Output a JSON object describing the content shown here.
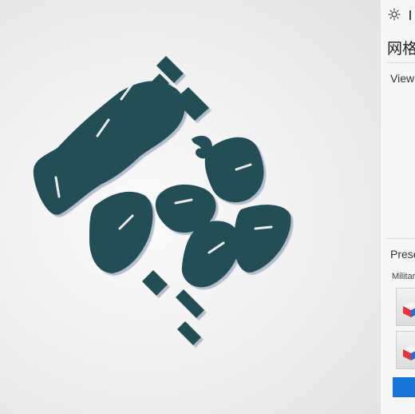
{
  "panel": {
    "title": "网格",
    "viewport_label": "Viewp",
    "presets_label": "Prese",
    "preset_category": "Militar",
    "toolbar_icons": [
      "sun-icon",
      "panel-bar-icon"
    ],
    "preset_thumbs": [
      {
        "icon": "cube-icon",
        "colors": [
          "#e8343f",
          "#1b6fd6",
          "#f4f4f4"
        ]
      },
      {
        "icon": "cube-icon",
        "colors": [
          "#e8343f",
          "#1b6fd6",
          "#f4f4f4"
        ]
      }
    ],
    "apply_button_color": "#1a73d9"
  },
  "viewport": {
    "model_color": "#234e55",
    "model_shadow_color": "#7a8ea6",
    "background": "#eeeeee"
  }
}
